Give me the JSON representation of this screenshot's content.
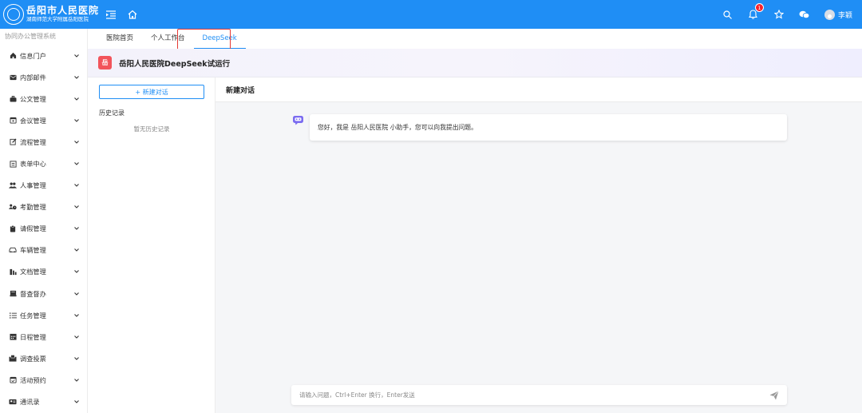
{
  "header": {
    "logo_title": "岳阳市人民医院",
    "logo_subtitle": "湖南师范大学附属岳阳医院",
    "notification_count": "1",
    "username": "李颖",
    "colors": {
      "bar": "#1f8ef5",
      "badge": "#f5222d"
    },
    "icons": [
      "menu-fold-icon",
      "home-icon",
      "search-icon",
      "bell-icon",
      "star-icon",
      "wechat-icon",
      "user-avatar-icon"
    ]
  },
  "sidebar": {
    "system_title": "协同办公管理系统",
    "items": [
      {
        "label": "信息门户",
        "icon": "home-icon"
      },
      {
        "label": "内部邮件",
        "icon": "mail-icon"
      },
      {
        "label": "公文管理",
        "icon": "briefcase-icon"
      },
      {
        "label": "会议管理",
        "icon": "calendar-icon"
      },
      {
        "label": "流程管理",
        "icon": "edit-icon"
      },
      {
        "label": "表单中心",
        "icon": "form-icon"
      },
      {
        "label": "人事管理",
        "icon": "users-icon"
      },
      {
        "label": "考勤管理",
        "icon": "clock-users-icon"
      },
      {
        "label": "请假管理",
        "icon": "clipboard-icon"
      },
      {
        "label": "车辆管理",
        "icon": "car-icon"
      },
      {
        "label": "文档管理",
        "icon": "document-icon"
      },
      {
        "label": "督查督办",
        "icon": "inbox-icon"
      },
      {
        "label": "任务管理",
        "icon": "list-icon"
      },
      {
        "label": "日程管理",
        "icon": "calendar-grid-icon"
      },
      {
        "label": "调查投票",
        "icon": "vote-icon"
      },
      {
        "label": "活动预约",
        "icon": "calendar-check-icon"
      },
      {
        "label": "通讯录",
        "icon": "contact-card-icon"
      }
    ]
  },
  "tabs": [
    {
      "label": "医院首页",
      "active": false
    },
    {
      "label": "个人工作台",
      "active": false
    },
    {
      "label": "DeepSeek",
      "active": true
    }
  ],
  "banner": {
    "logo_char": "岳",
    "title": "岳阳人民医院DeepSeek试运行",
    "logo_color": "#f2545b"
  },
  "history": {
    "new_chat_label": "+ 新建对话",
    "title": "历史记录",
    "empty_text": "暂无历史记录"
  },
  "chat": {
    "title": "新建对话",
    "welcome_message": "您好，我是 岳阳人民医院 小助手，您可以向我提出问题。",
    "input_placeholder": "请输入问题，Ctrl+Enter 换行，Enter发送",
    "input_value": ""
  }
}
